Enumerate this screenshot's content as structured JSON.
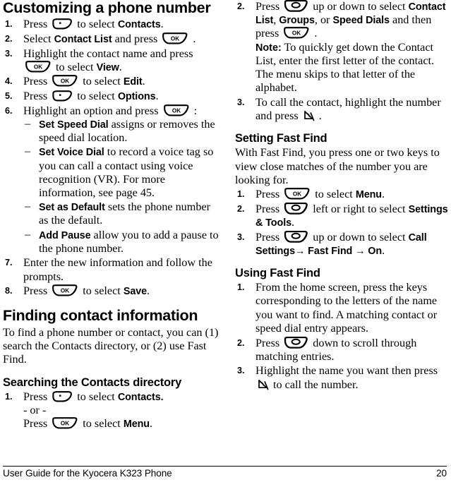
{
  "document": {
    "footer_text": "User Guide for the Kyocera K323 Phone",
    "page_number": "20"
  },
  "icons": {
    "soft_key_left": "left-soft-key-icon",
    "ok_key": "ok-key-icon",
    "ok_label": "OK",
    "navigation_key": "navigation-key-icon",
    "send_key": "send-key-icon"
  },
  "left_column": {
    "heading": "Customizing a phone number",
    "steps": [
      {
        "num": "1.",
        "parts": [
          {
            "t": "text",
            "v": "Press "
          },
          {
            "t": "key",
            "v": "soft_key_left"
          },
          {
            "t": "text",
            "v": " to select "
          },
          {
            "t": "bold",
            "v": "Contacts"
          },
          {
            "t": "text",
            "v": "."
          }
        ]
      },
      {
        "num": "2.",
        "parts": [
          {
            "t": "text",
            "v": "Select "
          },
          {
            "t": "bold",
            "v": "Contact List"
          },
          {
            "t": "text",
            "v": " and press "
          },
          {
            "t": "key",
            "v": "ok_key"
          },
          {
            "t": "text",
            "v": " ."
          }
        ]
      },
      {
        "num": "3.",
        "parts": [
          {
            "t": "text",
            "v": "Highlight the contact name and press "
          },
          {
            "t": "key",
            "v": "ok_key"
          },
          {
            "t": "text",
            "v": " to select "
          },
          {
            "t": "bold",
            "v": "View"
          },
          {
            "t": "text",
            "v": "."
          }
        ]
      },
      {
        "num": "4.",
        "parts": [
          {
            "t": "text",
            "v": "Press "
          },
          {
            "t": "key",
            "v": "ok_key"
          },
          {
            "t": "text",
            "v": " to select "
          },
          {
            "t": "bold",
            "v": "Edit"
          },
          {
            "t": "text",
            "v": "."
          }
        ]
      },
      {
        "num": "5.",
        "parts": [
          {
            "t": "text",
            "v": "Press "
          },
          {
            "t": "key",
            "v": "soft_key_left"
          },
          {
            "t": "text",
            "v": " to select "
          },
          {
            "t": "bold",
            "v": "Options"
          },
          {
            "t": "text",
            "v": "."
          }
        ]
      },
      {
        "num": "6.",
        "parts": [
          {
            "t": "text",
            "v": "Highlight an option and press "
          },
          {
            "t": "key",
            "v": "ok_key"
          },
          {
            "t": "text",
            "v": " :"
          }
        ],
        "sub_items": [
          [
            {
              "t": "bold",
              "v": "Set Speed Dial"
            },
            {
              "t": "text",
              "v": " assigns or removes the speed dial location."
            }
          ],
          [
            {
              "t": "bold",
              "v": "Set Voice Dial"
            },
            {
              "t": "text",
              "v": " to record a voice tag so you can call a contact using voice recognition (VR). For more information, see page 45."
            }
          ],
          [
            {
              "t": "bold",
              "v": "Set as Default"
            },
            {
              "t": "text",
              "v": " sets the phone number as the default."
            }
          ],
          [
            {
              "t": "bold",
              "v": "Add Pause"
            },
            {
              "t": "text",
              "v": " allow you to add a pause to the phone number."
            }
          ]
        ]
      },
      {
        "num": "7.",
        "parts": [
          {
            "t": "text",
            "v": "Enter the new information and follow the prompts."
          }
        ]
      },
      {
        "num": "8.",
        "parts": [
          {
            "t": "text",
            "v": "Press "
          },
          {
            "t": "key",
            "v": "ok_key"
          },
          {
            "t": "text",
            "v": " to select "
          },
          {
            "t": "bold",
            "v": "Save"
          },
          {
            "t": "text",
            "v": "."
          }
        ]
      }
    ],
    "finding_heading": "Finding contact information",
    "finding_body": "To find a phone number or contact, you can (1) search the Contacts directory, or (2) use Fast Find.",
    "searching_heading": "Searching the Contacts directory",
    "searching_steps": [
      {
        "num": "1.",
        "parts": [
          {
            "t": "text",
            "v": "Press "
          },
          {
            "t": "key",
            "v": "soft_key_left"
          },
          {
            "t": "text",
            "v": " to select "
          },
          {
            "t": "bold",
            "v": "Contacts."
          }
        ],
        "or_label": "- or -",
        "parts2": [
          {
            "t": "text",
            "v": "Press "
          },
          {
            "t": "key",
            "v": "ok_key"
          },
          {
            "t": "text",
            "v": " to select "
          },
          {
            "t": "bold",
            "v": "Menu"
          },
          {
            "t": "text",
            "v": "."
          }
        ]
      }
    ]
  },
  "right_column": {
    "steps": [
      {
        "num": "2.",
        "parts": [
          {
            "t": "text",
            "v": "Press "
          },
          {
            "t": "key",
            "v": "navigation_key"
          },
          {
            "t": "text",
            "v": " up or down to select "
          },
          {
            "t": "bold",
            "v": "Contact List"
          },
          {
            "t": "text",
            "v": ", "
          },
          {
            "t": "bold",
            "v": "Groups"
          },
          {
            "t": "text",
            "v": ", or "
          },
          {
            "t": "bold",
            "v": "Speed Dials"
          },
          {
            "t": "text",
            "v": " and then press "
          },
          {
            "t": "key",
            "v": "ok_key"
          },
          {
            "t": "text",
            "v": " ."
          }
        ],
        "note_label": "Note:",
        "note_text": " To quickly get down the Contact List, enter the first letter of the contact. The menu skips to that letter of the alphabet."
      },
      {
        "num": "3.",
        "parts": [
          {
            "t": "text",
            "v": "To call the contact, highlight the number and press "
          },
          {
            "t": "key",
            "v": "send_key"
          },
          {
            "t": "text",
            "v": " ."
          }
        ]
      }
    ],
    "setting_heading": "Setting Fast Find",
    "setting_body": "With Fast Find, you press one or two keys to view close matches of the number you are looking for.",
    "setting_steps": [
      {
        "num": "1.",
        "parts": [
          {
            "t": "text",
            "v": "Press "
          },
          {
            "t": "key",
            "v": "ok_key"
          },
          {
            "t": "text",
            "v": " to select "
          },
          {
            "t": "bold",
            "v": "Menu"
          },
          {
            "t": "text",
            "v": "."
          }
        ]
      },
      {
        "num": "2.",
        "parts": [
          {
            "t": "text",
            "v": "Press "
          },
          {
            "t": "key",
            "v": "navigation_key"
          },
          {
            "t": "text",
            "v": " left or right to select "
          },
          {
            "t": "bold",
            "v": "Settings & Tools"
          },
          {
            "t": "text",
            "v": "."
          }
        ]
      },
      {
        "num": "3.",
        "parts": [
          {
            "t": "text",
            "v": "Press "
          },
          {
            "t": "key",
            "v": "navigation_key"
          },
          {
            "t": "text",
            "v": " up or down to select "
          },
          {
            "t": "bold",
            "v": "Call Settings→ Fast Find → On"
          },
          {
            "t": "text",
            "v": "."
          }
        ]
      }
    ],
    "using_heading": "Using Fast Find",
    "using_steps": [
      {
        "num": "1.",
        "parts": [
          {
            "t": "text",
            "v": "From the home screen, press the keys corresponding to the letters of the name you want to find. A matching contact or speed dial entry appears."
          }
        ]
      },
      {
        "num": "2.",
        "parts": [
          {
            "t": "text",
            "v": "Press "
          },
          {
            "t": "key",
            "v": "navigation_key"
          },
          {
            "t": "text",
            "v": " down to scroll through matching entries."
          }
        ]
      },
      {
        "num": "3.",
        "parts": [
          {
            "t": "text",
            "v": "Highlight the name you want then press "
          },
          {
            "t": "key",
            "v": "send_key"
          },
          {
            "t": "text",
            "v": " to call the number."
          }
        ]
      }
    ]
  }
}
